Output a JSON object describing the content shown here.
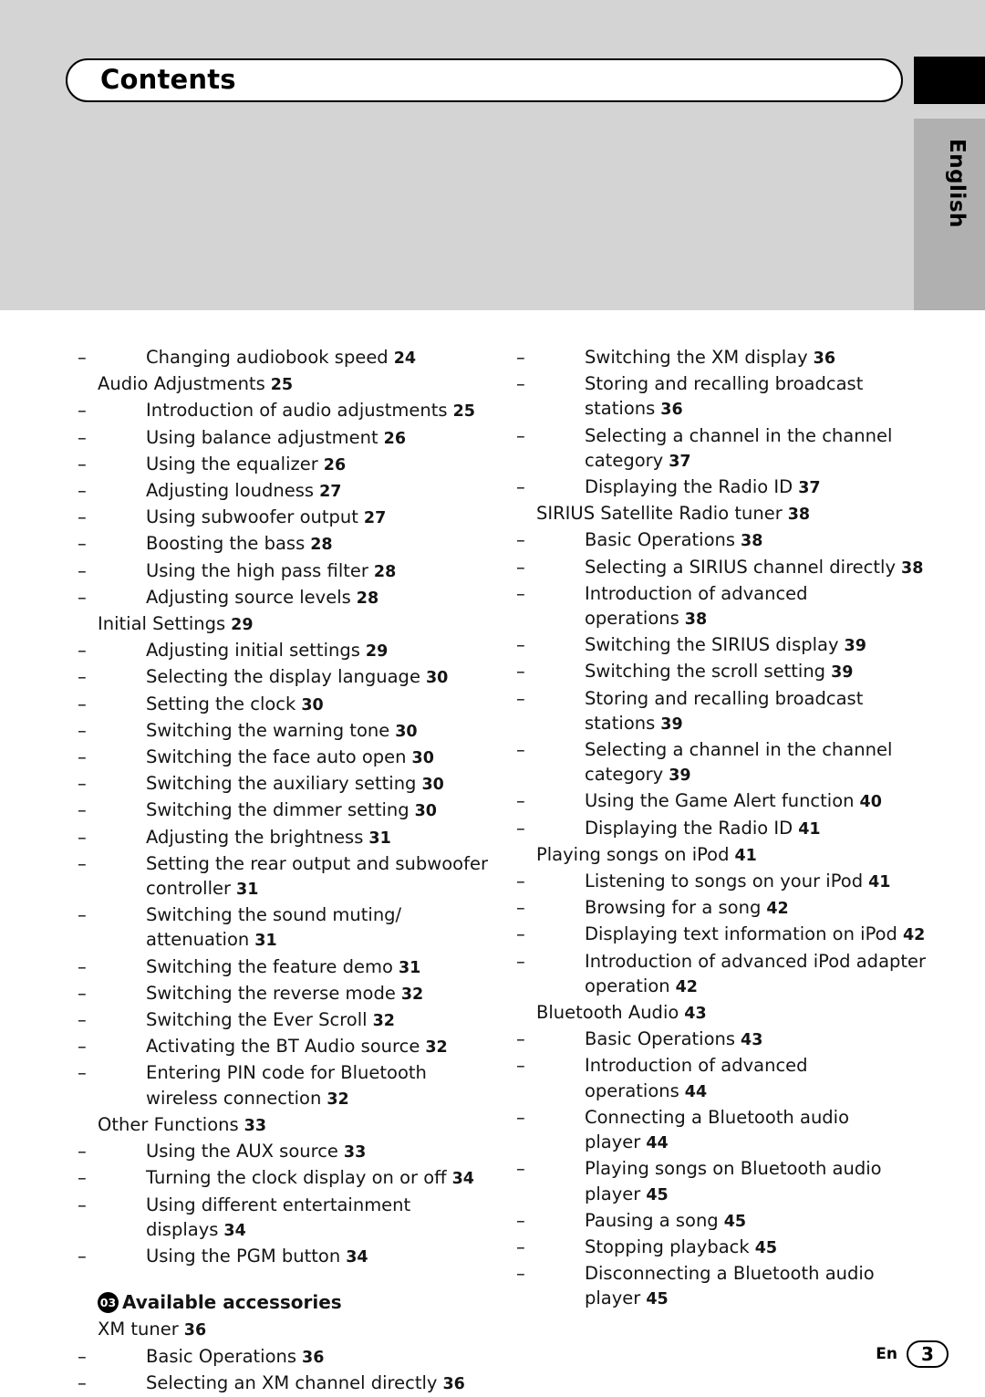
{
  "header": {
    "title": "Contents",
    "language_tab": "English"
  },
  "footer": {
    "en_label": "En",
    "page_number": "3"
  },
  "left_column": [
    {
      "type": "sub",
      "label": "Changing audiobook speed",
      "page": "24"
    },
    {
      "type": "main",
      "label": "Audio Adjustments",
      "page": "25"
    },
    {
      "type": "sub",
      "label": "Introduction of audio adjustments",
      "page": "25"
    },
    {
      "type": "sub",
      "label": "Using balance adjustment",
      "page": "26"
    },
    {
      "type": "sub",
      "label": "Using the equalizer",
      "page": "26"
    },
    {
      "type": "sub",
      "label": "Adjusting loudness",
      "page": "27"
    },
    {
      "type": "sub",
      "label": "Using subwoofer output",
      "page": "27"
    },
    {
      "type": "sub",
      "label": "Boosting the bass",
      "page": "28"
    },
    {
      "type": "sub",
      "label": "Using the high pass filter",
      "page": "28"
    },
    {
      "type": "sub",
      "label": "Adjusting source levels",
      "page": "28"
    },
    {
      "type": "main",
      "label": "Initial Settings",
      "page": "29"
    },
    {
      "type": "sub",
      "label": "Adjusting initial settings",
      "page": "29"
    },
    {
      "type": "sub",
      "label": "Selecting the display language",
      "page": "30"
    },
    {
      "type": "sub",
      "label": "Setting the clock",
      "page": "30"
    },
    {
      "type": "sub",
      "label": "Switching the warning tone",
      "page": "30"
    },
    {
      "type": "sub",
      "label": "Switching the face auto open",
      "page": "30"
    },
    {
      "type": "sub",
      "label": "Switching the auxiliary setting",
      "page": "30"
    },
    {
      "type": "sub",
      "label": "Switching the dimmer setting",
      "page": "30"
    },
    {
      "type": "sub",
      "label": "Adjusting the brightness",
      "page": "31"
    },
    {
      "type": "sub",
      "label": "Setting the rear output and subwoofer controller",
      "page": "31"
    },
    {
      "type": "sub",
      "label": "Switching the sound muting/ attenuation",
      "page": "31"
    },
    {
      "type": "sub",
      "label": "Switching the feature demo",
      "page": "31"
    },
    {
      "type": "sub",
      "label": "Switching the reverse mode",
      "page": "32"
    },
    {
      "type": "sub",
      "label": "Switching the Ever Scroll",
      "page": "32"
    },
    {
      "type": "sub",
      "label": "Activating the BT Audio source",
      "page": "32"
    },
    {
      "type": "sub",
      "label": "Entering PIN code for Bluetooth wireless connection",
      "page": "32"
    },
    {
      "type": "main",
      "label": "Other Functions",
      "page": "33"
    },
    {
      "type": "sub",
      "label": "Using the AUX source",
      "page": "33"
    },
    {
      "type": "sub",
      "label": "Turning the clock display on or off",
      "page": "34"
    },
    {
      "type": "sub",
      "label": "Using different entertainment displays",
      "page": "34"
    },
    {
      "type": "sub",
      "label": "Using the PGM button",
      "page": "34"
    },
    {
      "type": "chapter",
      "number": "03",
      "label": "Available accessories"
    },
    {
      "type": "main",
      "label": "XM tuner",
      "page": "36"
    },
    {
      "type": "sub",
      "label": "Basic Operations",
      "page": "36"
    },
    {
      "type": "sub",
      "label": "Selecting an XM channel directly",
      "page": "36"
    }
  ],
  "right_column": [
    {
      "type": "sub",
      "label": "Switching the XM display",
      "page": "36"
    },
    {
      "type": "sub",
      "label": "Storing and recalling broadcast stations",
      "page": "36"
    },
    {
      "type": "sub",
      "label": "Selecting a channel in the channel category",
      "page": "37"
    },
    {
      "type": "sub",
      "label": "Displaying the Radio ID",
      "page": "37"
    },
    {
      "type": "main",
      "label": "SIRIUS Satellite Radio tuner",
      "page": "38"
    },
    {
      "type": "sub",
      "label": "Basic Operations",
      "page": "38"
    },
    {
      "type": "sub",
      "label": "Selecting a SIRIUS channel directly",
      "page": "38"
    },
    {
      "type": "sub",
      "label": "Introduction of advanced operations",
      "page": "38"
    },
    {
      "type": "sub",
      "label": "Switching the SIRIUS display",
      "page": "39"
    },
    {
      "type": "sub",
      "label": "Switching the scroll setting",
      "page": "39"
    },
    {
      "type": "sub",
      "label": "Storing and recalling broadcast stations",
      "page": "39"
    },
    {
      "type": "sub",
      "label": "Selecting a channel in the channel category",
      "page": "39"
    },
    {
      "type": "sub",
      "label": "Using the Game Alert function",
      "page": "40"
    },
    {
      "type": "sub",
      "label": "Displaying the Radio ID",
      "page": "41"
    },
    {
      "type": "main",
      "label": "Playing songs on iPod",
      "page": "41"
    },
    {
      "type": "sub",
      "label": "Listening to songs on your iPod",
      "page": "41"
    },
    {
      "type": "sub",
      "label": "Browsing for a song",
      "page": "42"
    },
    {
      "type": "sub",
      "label": "Displaying text information on iPod",
      "page": "42"
    },
    {
      "type": "sub",
      "label": "Introduction of advanced iPod adapter operation",
      "page": "42"
    },
    {
      "type": "main",
      "label": "Bluetooth Audio",
      "page": "43"
    },
    {
      "type": "sub",
      "label": "Basic Operations",
      "page": "43"
    },
    {
      "type": "sub",
      "label": "Introduction of advanced operations",
      "page": "44"
    },
    {
      "type": "sub",
      "label": "Connecting a Bluetooth audio player",
      "page": "44"
    },
    {
      "type": "sub",
      "label": "Playing songs on Bluetooth audio player",
      "page": "45"
    },
    {
      "type": "sub",
      "label": "Pausing a song",
      "page": "45"
    },
    {
      "type": "sub",
      "label": "Stopping playback",
      "page": "45"
    },
    {
      "type": "sub",
      "label": "Disconnecting a Bluetooth audio player",
      "page": "45"
    }
  ]
}
